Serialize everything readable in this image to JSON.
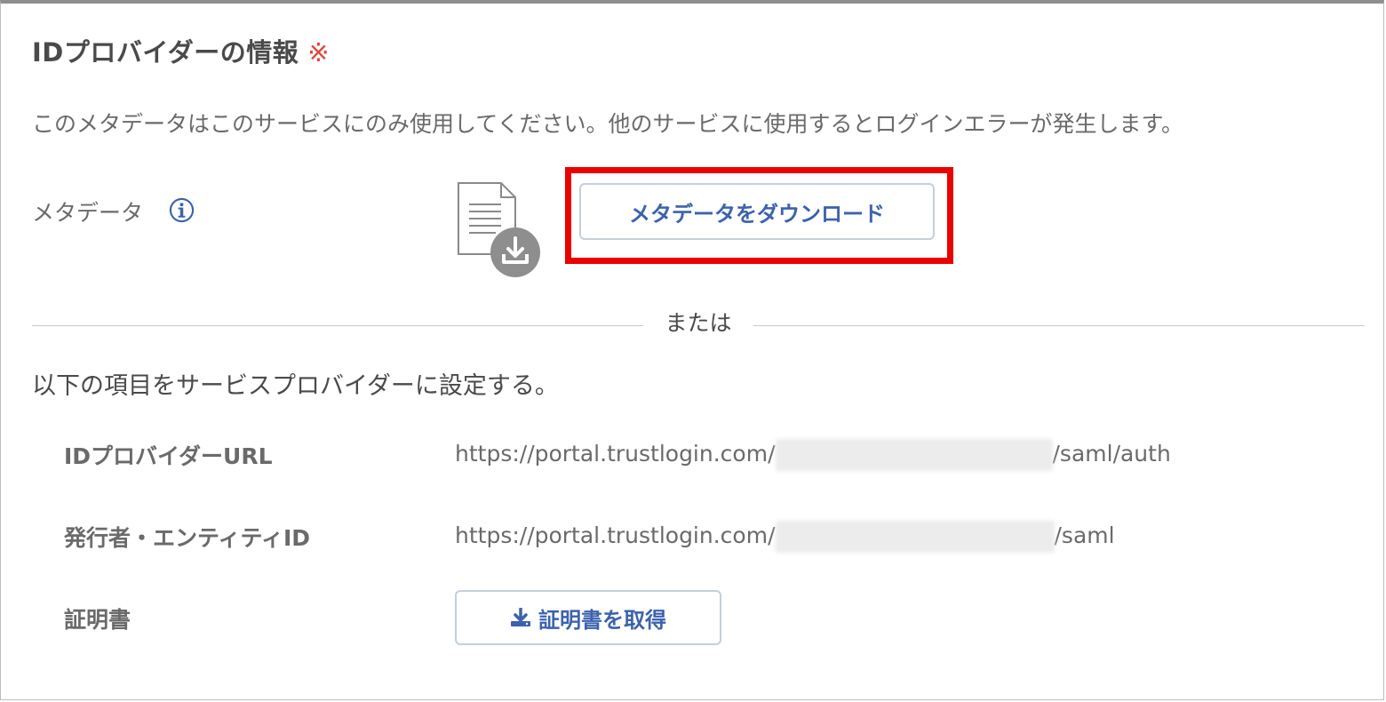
{
  "section": {
    "title": "IDプロバイダーの情報",
    "required_mark": "※",
    "description": "このメタデータはこのサービスにのみ使用してください。他のサービスに使用するとログインエラーが発生します。"
  },
  "metadata": {
    "label": "メタデータ",
    "info_icon": "info-circle-icon",
    "file_icon": "document-download-icon",
    "download_button": "メタデータをダウンロード"
  },
  "separator": {
    "label": "または"
  },
  "instructions": "以下の項目をサービスプロバイダーに設定する。",
  "fields": [
    {
      "label": "IDプロバイダーURL",
      "value_prefix": "https://portal.trustlogin.com/",
      "value_suffix": "/saml/auth"
    },
    {
      "label": "発行者・エンティティID",
      "value_prefix": "https://portal.trustlogin.com/",
      "value_suffix": "/saml"
    },
    {
      "label": "証明書",
      "button": "証明書を取得",
      "button_icon": "download-icon"
    }
  ],
  "colors": {
    "accent": "#3c62ad",
    "highlight": "#ec0000",
    "required": "#e0473d",
    "text": "#4a4a4a",
    "muted": "#6a6a6a"
  }
}
